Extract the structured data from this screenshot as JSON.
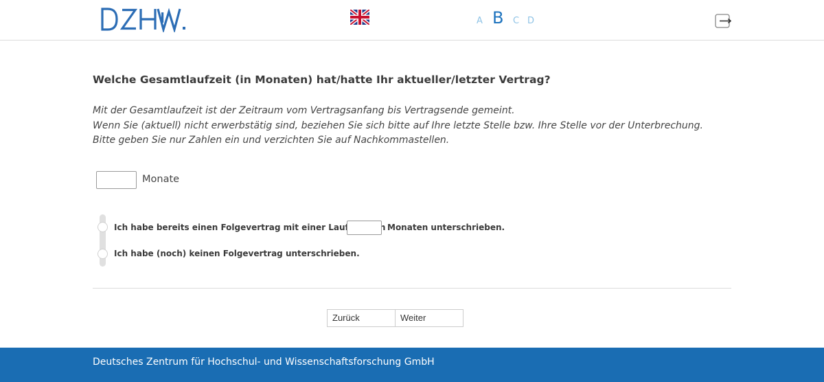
{
  "header": {
    "logo_text": "DZHW.",
    "language_flag": "uk-flag-icon",
    "font_sizes": [
      "A",
      "B",
      "C",
      "D"
    ],
    "logout_icon": "logout-icon",
    "brand_color": "#1e73be"
  },
  "main": {
    "question": "Welche Gesamtlaufzeit (in Monaten) hat/hatte Ihr aktueller/letzter Vertrag?",
    "info_lines": [
      "Mit der Gesamtlaufzeit ist der Zeitraum vom Vertragsanfang bis Vertragsende gemeint.",
      "Wenn Sie (aktuell) nicht erwerbstätig sind, beziehen Sie sich bitte auf Ihre letzte Stelle bzw. Ihre Stelle vor der Unterbrechung.",
      "Bitte geben Sie nur Zahlen ein und verzichten Sie auf Nachkommastellen."
    ],
    "months_value": "",
    "months_unit": "Monate",
    "options": {
      "option1_prefix": "Ich habe bereits einen Folgevertrag mit einer Laufzeit von",
      "option1_value": "",
      "option1_suffix": "Monaten unterschrieben.",
      "option2": "Ich habe (noch) keinen Folgevertrag unterschrieben."
    }
  },
  "nav": {
    "back_label": "Zurück",
    "next_label": "Weiter"
  },
  "footer": {
    "text": "Deutsches Zentrum für Hochschul- und Wissenschaftsforschung GmbH",
    "color": "#1a6db3"
  }
}
